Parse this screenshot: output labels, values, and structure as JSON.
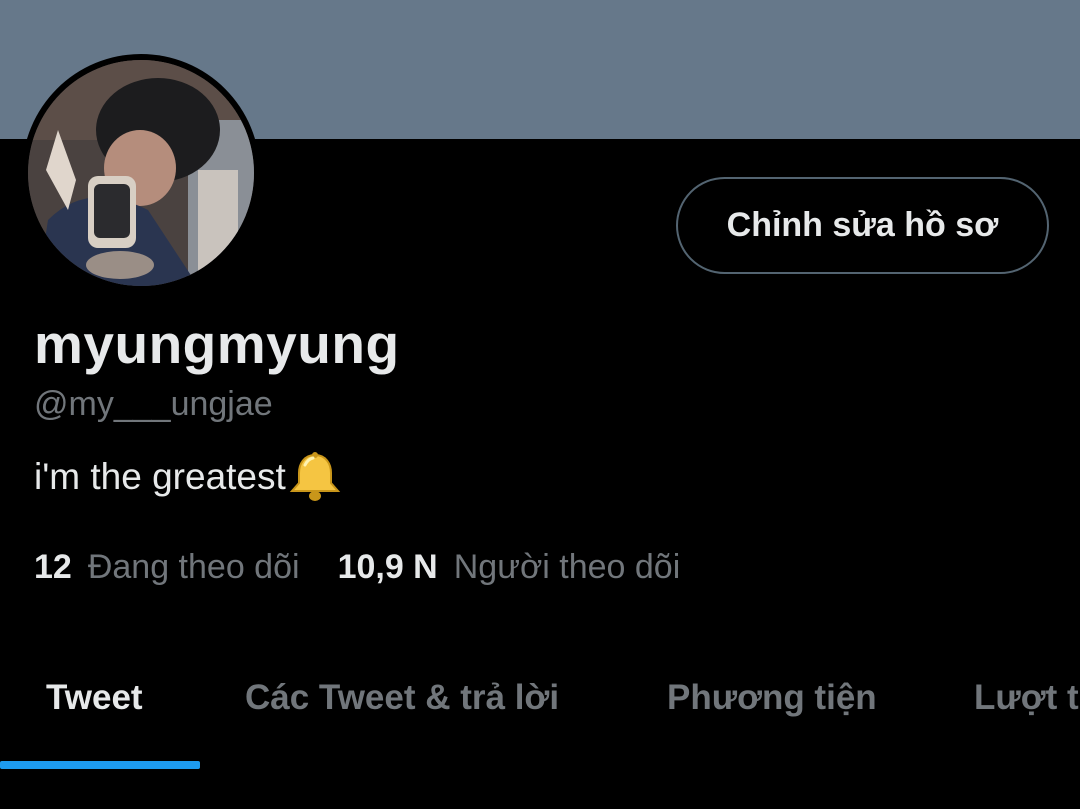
{
  "profile": {
    "display_name": "myungmyung",
    "handle": "@my___ungjae",
    "bio_text": "i'm the greatest",
    "bio_emoji": "bell-icon",
    "edit_button_label": "Chỉnh sửa hồ sơ"
  },
  "stats": {
    "following_count": "12",
    "following_label": "Đang theo dõi",
    "followers_count": "10,9 N",
    "followers_label": "Người theo dõi"
  },
  "tabs": [
    {
      "label": "Tweet",
      "active": true
    },
    {
      "label": "Các Tweet & trả lời",
      "active": false
    },
    {
      "label": "Phương tiện",
      "active": false
    },
    {
      "label": "Lượt thích",
      "active": false
    }
  ],
  "colors": {
    "banner": "#66788a",
    "background": "#000000",
    "primary_text": "#e7e9ea",
    "secondary_text": "#71767b",
    "accent": "#1d9bf0",
    "button_border": "#536471"
  }
}
